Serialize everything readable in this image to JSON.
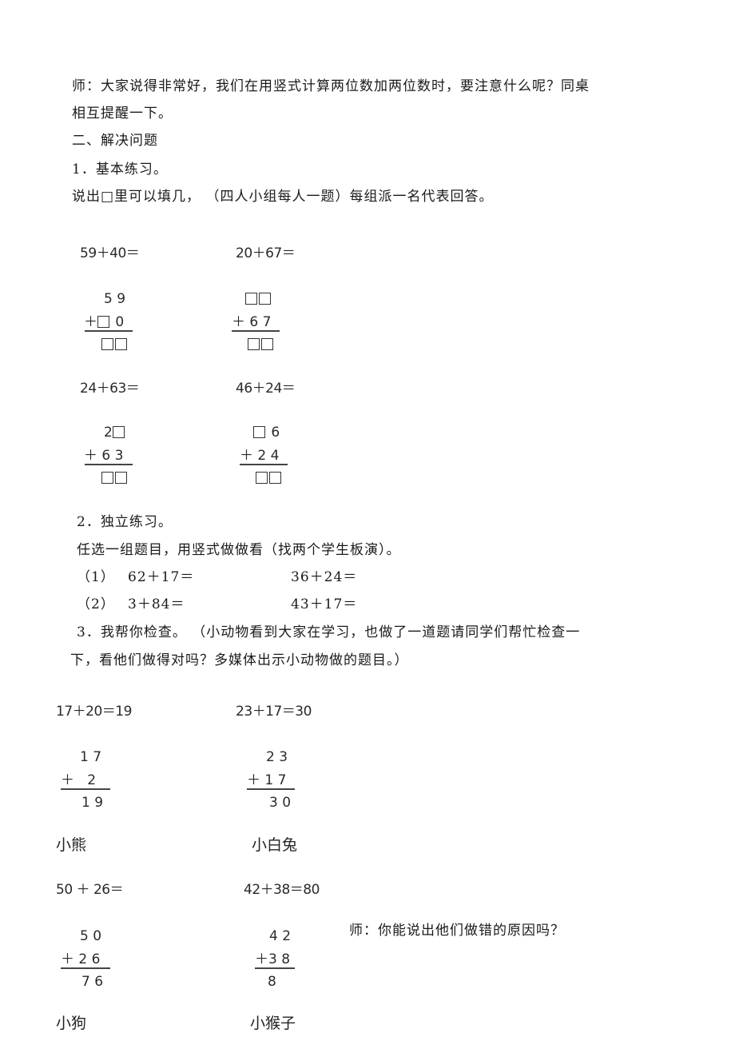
{
  "paragraphs": {
    "p1_line1": "师：大家说得非常好，我们在用竖式计算两位数加两位数时，要注意什么呢？同桌",
    "p1_line2": "相互提醒一下。",
    "section2": "二、解决问题",
    "item1_title": "1．基本练习。",
    "item1_desc": "说出□里可以填几，  （四人小组每人一题）每组派一名代表回答。",
    "item2_title": "2．独立练习。",
    "item2_desc": "任选一组题目，用竖式做做看（找两个学生板演）。",
    "item3_line1": "3．我帮你检查。  （小动物看到大家在学习，也做了一道题请同学们帮忙检查一",
    "item3_line2": "下，看他们做得对吗？多媒体出示小动物做的题目。）",
    "teacher_question": "师：你能说出他们做错的原因吗？"
  },
  "basic_practice": [
    {
      "equation": "59＋40＝",
      "top": "5 9",
      "add": "＋□ 0",
      "result": "□□"
    },
    {
      "equation": "20＋67＝",
      "top": "□□",
      "add": "＋ 6 7",
      "result": "□□"
    },
    {
      "equation": "24＋63＝",
      "top": "2□",
      "add": "＋ 6 3",
      "result": "□□"
    },
    {
      "equation": "46＋24＝",
      "top": "□ 6",
      "add": "＋ 2 4",
      "result": "□□"
    }
  ],
  "independent_practice": [
    {
      "label": "（1）",
      "a": "62＋17＝",
      "b": "36＋24＝"
    },
    {
      "label": "（2）",
      "a": "3＋84＝",
      "b": "43＋17＝"
    }
  ],
  "animal_work": [
    {
      "equation": "17＋20＝19",
      "top": "1 7",
      "add": "＋   2",
      "result": "1 9",
      "animal": "小熊"
    },
    {
      "equation": "23＋17＝30",
      "top": "2 3",
      "add": "＋ 1 7",
      "result": "3 0",
      "animal": "小白兔"
    },
    {
      "equation": "50 ＋ 26＝",
      "top": "5 0",
      "add": "＋ 2 6",
      "result": "7 6",
      "animal": "小狗"
    },
    {
      "equation": "42＋38＝80",
      "top": "4 2",
      "add": "＋3 8",
      "result": "8",
      "animal": "小猴子"
    }
  ]
}
